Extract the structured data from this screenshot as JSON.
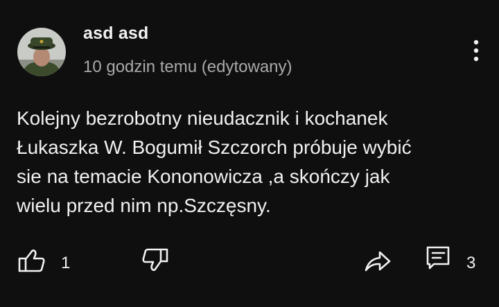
{
  "comment": {
    "author": "asd asd",
    "timestamp": "10 godzin temu (edytowany)",
    "text_lines": [
      "Kolejny bezrobotny nieudacznik i kochanek",
      "Łukaszka W. Bogumił Szczorch próbuje wybić",
      "sie na temacie Kononowicza ,a skończy jak",
      "wielu przed nim np.Szczęsny."
    ]
  },
  "actions": {
    "like_count": "1",
    "reply_count": "3"
  },
  "icons": {
    "menu": "more-vert-icon",
    "like": "thumb-up-icon",
    "dislike": "thumb-down-icon",
    "share": "share-arrow-icon",
    "reply": "comment-icon"
  },
  "colors": {
    "background": "#0f0f0f",
    "primary_text": "#f1f1f1",
    "secondary_text": "#aaaaaa"
  }
}
